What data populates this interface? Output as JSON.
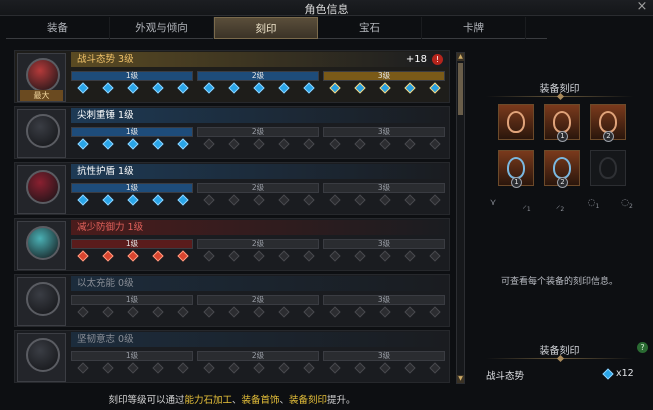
{
  "window": {
    "title": "角色信息",
    "close_glyph": "×"
  },
  "tabs": [
    "装备",
    "外观与倾向",
    "刻印",
    "宝石",
    "卡牌"
  ],
  "active_tab": "刻印",
  "engravings": [
    {
      "name": "战斗态势 3级",
      "name_color": "#f0c26a",
      "bar_color": "#5a4a22",
      "bonus": "+18",
      "warn": "!",
      "max_badge": "最大",
      "levels": [
        "1级",
        "2级",
        "3级"
      ],
      "filled_level": 3,
      "gem_type": "gold",
      "medal_color": "#b43a3a"
    },
    {
      "name": "尖刺重锤 1级",
      "name_color": "#ffffff",
      "bar_color": "#1e3a55",
      "levels": [
        "1级",
        "2级",
        "3级"
      ],
      "filled_level": 1,
      "gem_type": "blue",
      "medal_color": "#3a3d44"
    },
    {
      "name": "抗性护盾 1级",
      "name_color": "#ffffff",
      "bar_color": "#1e3a55",
      "levels": [
        "1级",
        "2级",
        "3级"
      ],
      "filled_level": 1,
      "gem_type": "blue",
      "medal_color": "#8a2030"
    },
    {
      "name": "减少防御力 1级",
      "name_color": "#e0605a",
      "bar_color": "#4a1c1c",
      "levels": [
        "1级",
        "2级",
        "3级"
      ],
      "filled_level": 1,
      "gem_type": "red",
      "medal_color": "#4ab0b4"
    },
    {
      "name": "以太充能 0级",
      "name_color": "#8a8e96",
      "bar_color": "#1c2c3c",
      "levels": [
        "1级",
        "2级",
        "3级"
      ],
      "filled_level": 0,
      "gem_type": "blue",
      "medal_color": "#3a3d44"
    },
    {
      "name": "坚韧意志 0级",
      "name_color": "#8a8e96",
      "bar_color": "#1c2c3c",
      "levels": [
        "1级",
        "2级",
        "3级"
      ],
      "filled_level": 0,
      "gem_type": "blue",
      "medal_color": "#3a3d44"
    }
  ],
  "hint": {
    "before": "刻印等级可以通过",
    "link1": "能力石加工",
    "sep1": "、",
    "link2": "装备首饰",
    "sep2": "、",
    "link3": "装备刻印",
    "after": "提升。"
  },
  "equip_engraving": {
    "title": "装备刻印",
    "slots": [
      {
        "icon": "amulet-icon",
        "badge": ""
      },
      {
        "icon": "earring-icon",
        "badge": "1"
      },
      {
        "icon": "earring-icon",
        "badge": "2"
      },
      {
        "icon": "ring-icon",
        "badge": "1"
      },
      {
        "icon": "ring-icon",
        "badge": "2"
      },
      {
        "icon": "ability-stone-icon",
        "badge": ""
      }
    ],
    "slot_filter_icons": [
      {
        "icon": "necklace-filter-icon",
        "sub": ""
      },
      {
        "icon": "earring-filter-icon",
        "sub": "1"
      },
      {
        "icon": "earring-filter-icon",
        "sub": "2"
      },
      {
        "icon": "ring-filter-icon",
        "sub": "1"
      },
      {
        "icon": "ring-filter-icon",
        "sub": "2"
      }
    ],
    "info": "可查看每个装备的刻印信息。"
  },
  "equipped_panel": {
    "title": "装备刻印",
    "help": "?",
    "engraving_name": "战斗态势",
    "count": "x12"
  }
}
